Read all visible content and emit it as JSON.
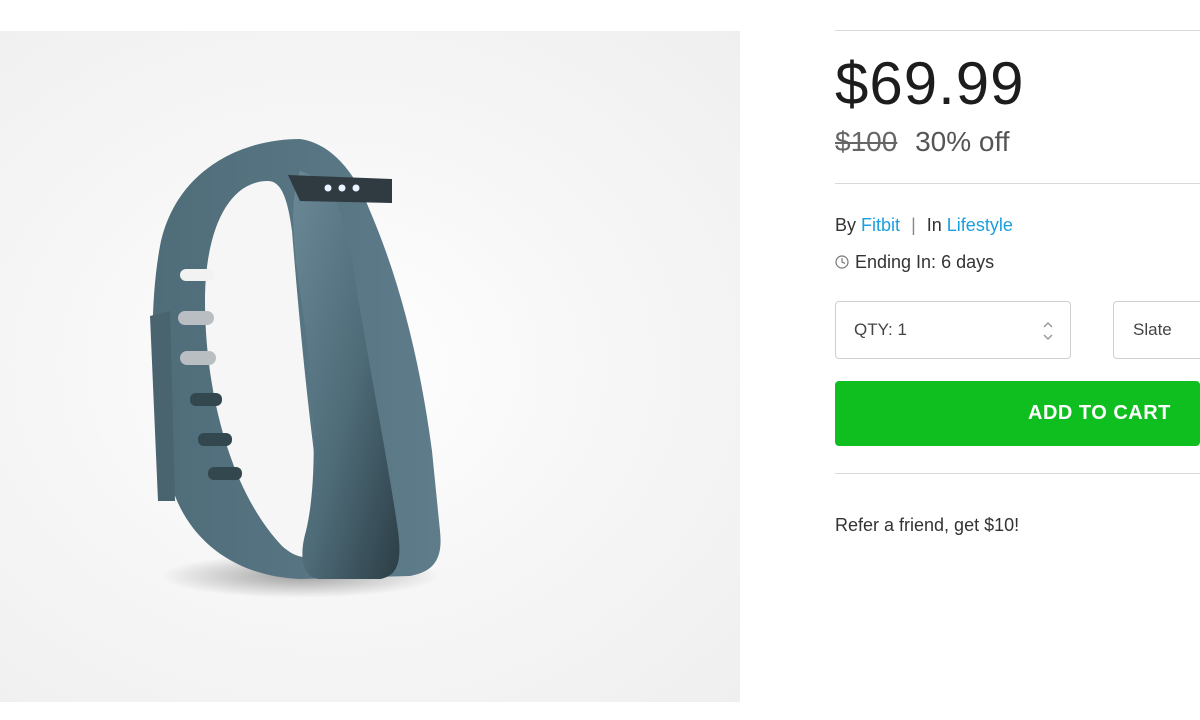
{
  "product": {
    "image_alt": "Fitbit Flex wristband in slate",
    "price": "$69.99",
    "original_price": "$100",
    "discount": "30% off",
    "by_label": "By",
    "brand": "Fitbit",
    "separator": "|",
    "in_label": "In",
    "category": "Lifestyle",
    "ending_label": "Ending In: 6 days",
    "icon_clock": "clock-icon",
    "qty_label": "QTY: 1",
    "variant": "Slate",
    "add_to_cart": "ADD TO CART",
    "refer": "Refer a friend, get $10!"
  },
  "colors": {
    "accent_green": "#0fbf1f",
    "link_blue": "#1a9fe0",
    "band_slate": "#587583"
  }
}
